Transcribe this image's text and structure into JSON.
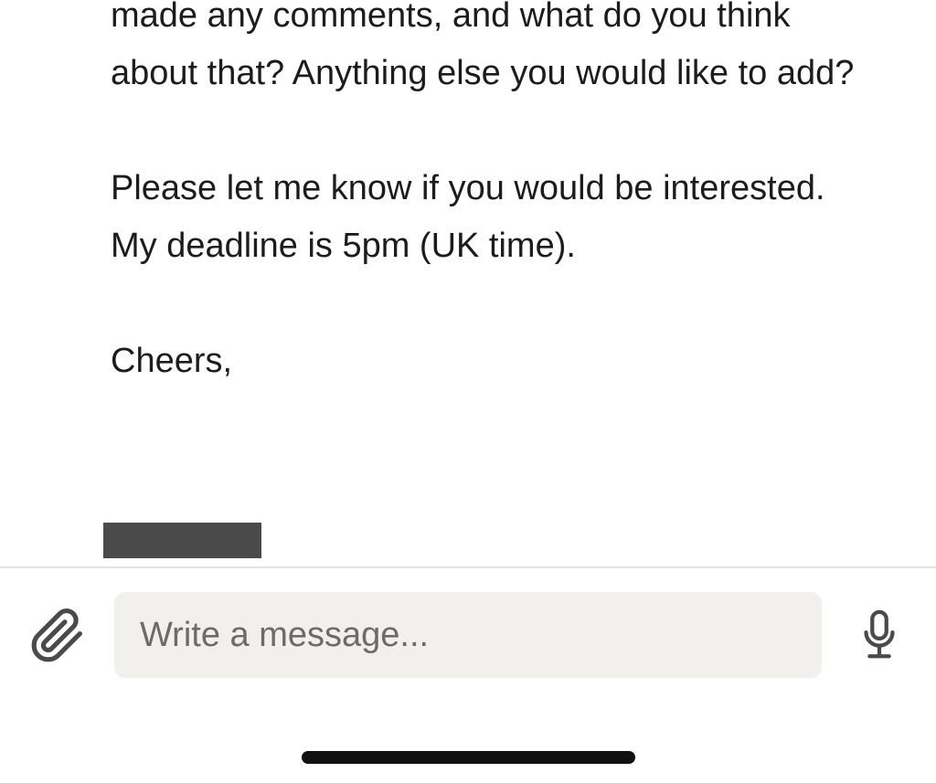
{
  "message": {
    "paragraphs": [
      "made any comments, and what do you think about that? Anything else you would like to add?",
      "Please let me know if you would be interested. My deadline is 5pm (UK time).",
      "Cheers,"
    ]
  },
  "composer": {
    "placeholder": "Write a message...",
    "attach_icon": "paperclip-icon",
    "mic_icon": "microphone-icon"
  },
  "colors": {
    "text": "#1c1c1c",
    "input_background": "#f1f0ed",
    "placeholder": "#6b6b6b",
    "redaction": "#4a4a4a"
  }
}
